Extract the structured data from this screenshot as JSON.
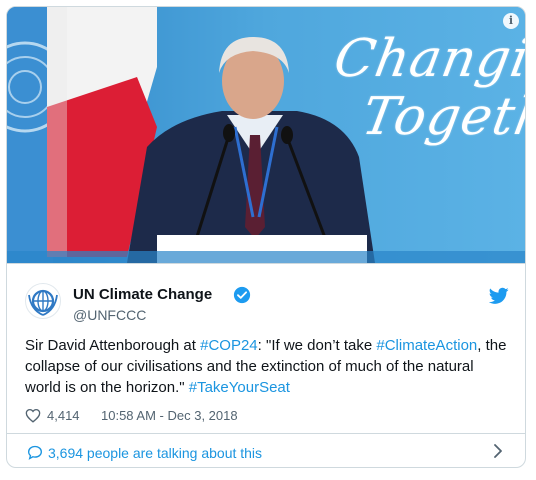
{
  "media": {
    "overlay_words": [
      "Changing",
      "Together"
    ],
    "info_glyph": "i"
  },
  "author": {
    "name": "UN Climate Change",
    "handle": "@UNFCCC",
    "verified": true,
    "avatar_icon": "unfccc-logo-icon"
  },
  "tweet": {
    "segments": [
      {
        "text": "Sir David Attenborough at ",
        "link": false
      },
      {
        "text": "#COP24",
        "link": true
      },
      {
        "text": ": \"If we don’t take ",
        "link": false
      },
      {
        "text": "#ClimateAction",
        "link": true
      },
      {
        "text": ", the collapse of our civilisations and the extinction of much of the natural world is on the horizon.\" ",
        "link": false
      },
      {
        "text": "#TakeYourSeat",
        "link": true
      }
    ]
  },
  "meta": {
    "likes": "4,414",
    "timestamp": "10:58 AM - Dec 3, 2018"
  },
  "footer": {
    "talking": "3,694 people are talking about this"
  },
  "colors": {
    "link": "#1b95e0",
    "text": "#0f1419",
    "muted": "#536471",
    "border": "#cfd9de",
    "banner_blue": "#4ea6dd",
    "flag_red": "#dc1e35"
  }
}
